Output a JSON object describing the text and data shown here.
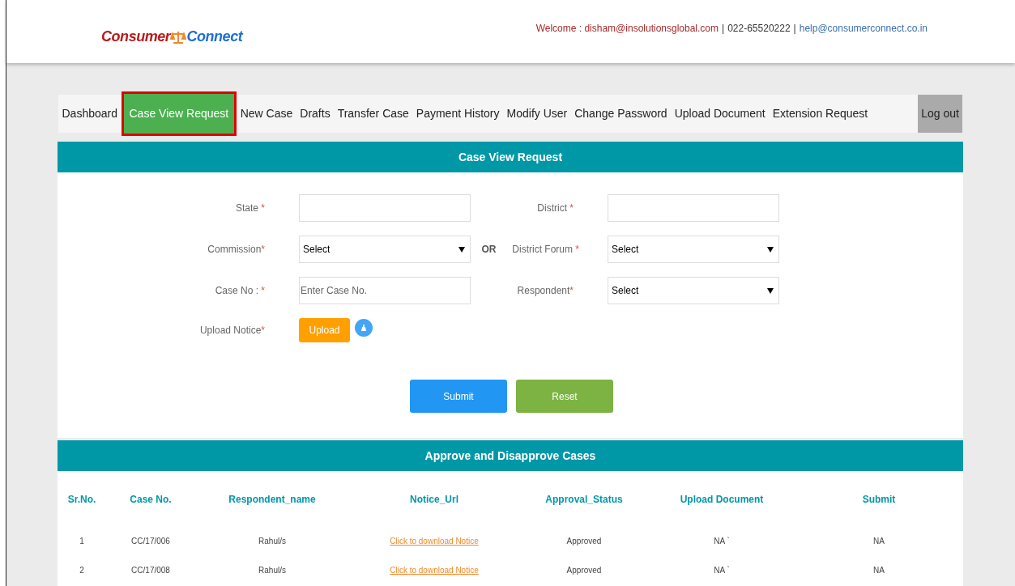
{
  "header": {
    "logo_left": "Consumer",
    "logo_right": "Connect",
    "welcome": "Welcome : disham@insolutionsglobal.com",
    "separator_1": "|",
    "phone": "022-65520222",
    "separator_2": "|",
    "email": "help@consumerconnect.co.in"
  },
  "nav": {
    "items": [
      {
        "label": "Dashboard",
        "selected": false
      },
      {
        "label": "Case View Request",
        "selected": true
      },
      {
        "label": "New Case",
        "selected": false
      },
      {
        "label": "Drafts",
        "selected": false
      },
      {
        "label": "Transfer Case",
        "selected": false
      },
      {
        "label": "Payment History",
        "selected": false
      },
      {
        "label": "Modify User",
        "selected": false
      },
      {
        "label": "Change Password",
        "selected": false
      },
      {
        "label": "Upload Document",
        "selected": false
      },
      {
        "label": "Extension Request",
        "selected": false
      }
    ],
    "logout": "Log out"
  },
  "form": {
    "title": "Case View Request",
    "state": {
      "label": "State",
      "required": "*"
    },
    "district": {
      "label": "District",
      "required": "*"
    },
    "commission": {
      "label": "Commission",
      "required": "*",
      "value": "Select"
    },
    "or": "OR",
    "district_forum": {
      "label": "District Forum",
      "required": "*",
      "value": "Select"
    },
    "case_no": {
      "label": "Case No :",
      "required": "*",
      "placeholder": "Enter Case No."
    },
    "respondent": {
      "label": "Respondent",
      "required": "*",
      "value": "Select"
    },
    "upload_notice": {
      "label": "Upload Notice",
      "required": "*",
      "button": "Upload"
    },
    "submit": "Submit",
    "reset": "Reset"
  },
  "table": {
    "title": "Approve and Disapprove Cases",
    "columns": [
      "Sr.No.",
      "Case No.",
      "Respondent_name",
      "Notice_Url",
      "Approval_Status",
      "Upload Document",
      "Submit"
    ],
    "rows": [
      [
        "1",
        "CC/17/006",
        "Rahul/s",
        "Click to download Notice",
        "Approved",
        "NA `",
        "NA"
      ],
      [
        "2",
        "CC/17/008",
        "Rahul/s",
        "Click to download Notice",
        "Approved",
        "NA `",
        "NA"
      ]
    ]
  }
}
